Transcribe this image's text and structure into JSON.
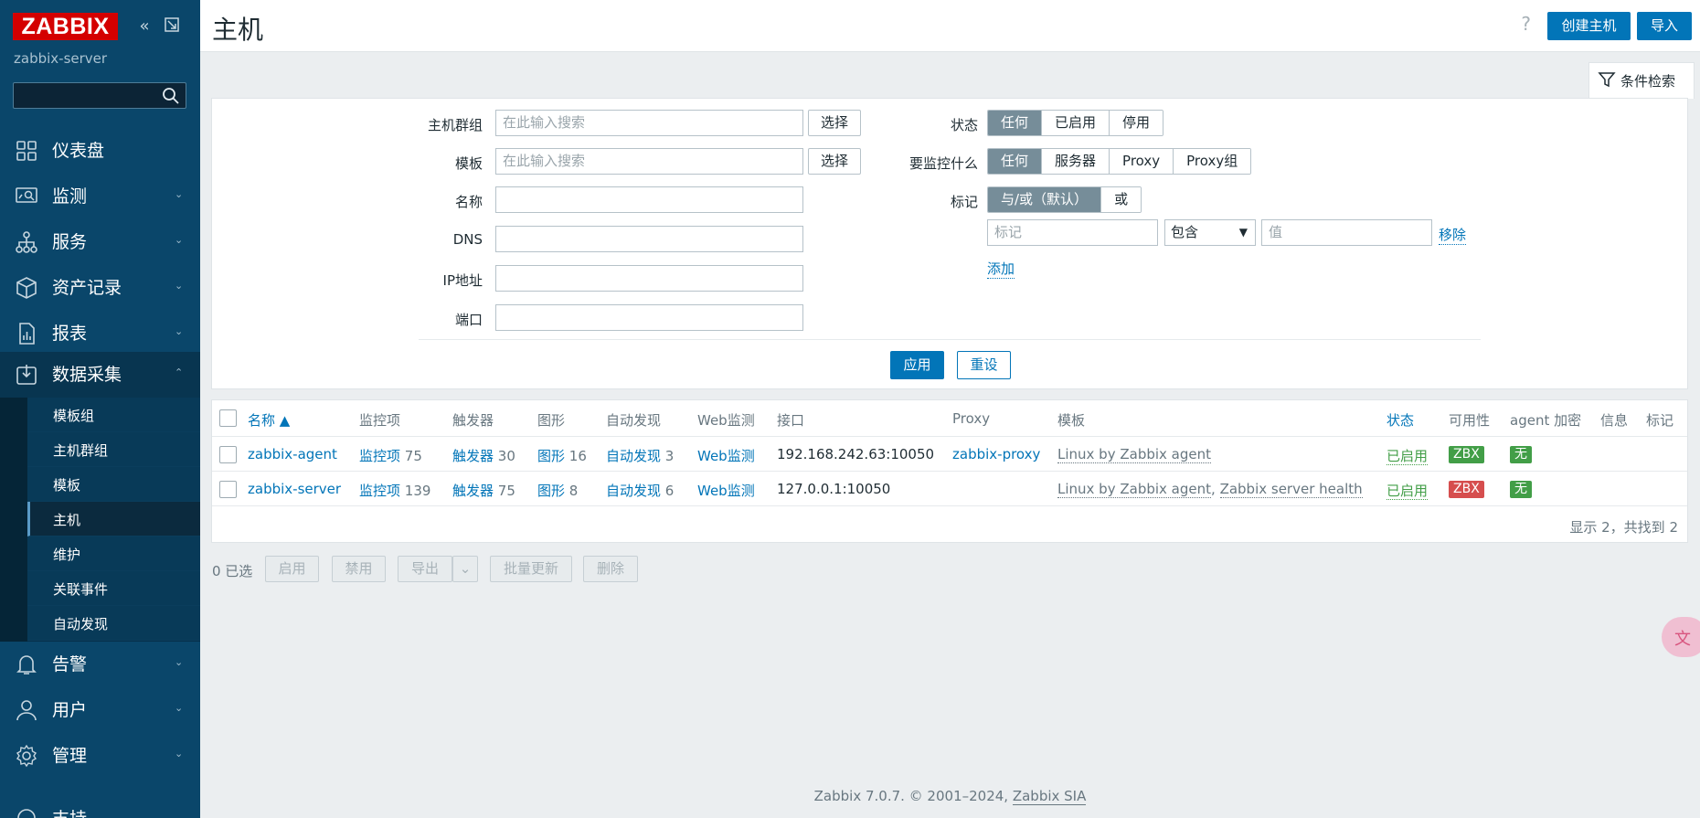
{
  "sidebar": {
    "logo": "ZABBIX",
    "server_name": "zabbix-server",
    "search_value": "",
    "menu": [
      {
        "label": "仪表盘"
      },
      {
        "label": "监测"
      },
      {
        "label": "服务"
      },
      {
        "label": "资产记录"
      },
      {
        "label": "报表"
      },
      {
        "label": "数据采集"
      },
      {
        "label": "告警"
      },
      {
        "label": "用户"
      },
      {
        "label": "管理"
      },
      {
        "label": "支持"
      }
    ],
    "submenu": [
      {
        "label": "模板组"
      },
      {
        "label": "主机群组"
      },
      {
        "label": "模板"
      },
      {
        "label": "主机"
      },
      {
        "label": "维护"
      },
      {
        "label": "关联事件"
      },
      {
        "label": "自动发现"
      }
    ]
  },
  "header": {
    "title": "主机",
    "help": "?",
    "create_button": "创建主机",
    "import_button": "导入"
  },
  "filter": {
    "tab_label": "条件检索",
    "host_groups_label": "主机群组",
    "host_groups_placeholder": "在此输入搜索",
    "templates_label": "模板",
    "templates_placeholder": "在此输入搜索",
    "select_button": "选择",
    "name_label": "名称",
    "dns_label": "DNS",
    "ip_label": "IP地址",
    "port_label": "端口",
    "status_label": "状态",
    "status_options": [
      "任何",
      "已启用",
      "停用"
    ],
    "monitored_by_label": "要监控什么",
    "monitored_by_options": [
      "任何",
      "服务器",
      "Proxy",
      "Proxy组"
    ],
    "tags_label": "标记",
    "tags_options": [
      "与/或（默认）",
      "或"
    ],
    "tag_placeholder": "标记",
    "tag_operator": "包含",
    "value_placeholder": "值",
    "remove_link": "移除",
    "add_link": "添加",
    "apply_button": "应用",
    "reset_button": "重设"
  },
  "table": {
    "columns": [
      "名称 ▲",
      "监控项",
      "触发器",
      "图形",
      "自动发现",
      "Web监测",
      "接口",
      "Proxy",
      "模板",
      "状态",
      "可用性",
      "agent 加密",
      "信息",
      "标记"
    ],
    "rows": [
      {
        "name": "zabbix-agent",
        "items_label": "监控项",
        "items_count": "75",
        "triggers_label": "触发器",
        "triggers_count": "30",
        "graphs_label": "图形",
        "graphs_count": "16",
        "discovery_label": "自动发现",
        "discovery_count": "3",
        "web": "Web监测",
        "interface": "192.168.242.63:10050",
        "proxy": "zabbix-proxy",
        "templates": [
          "Linux by Zabbix agent"
        ],
        "status": "已启用",
        "availability": "ZBX",
        "availability_color": "#429e47",
        "encryption": "无"
      },
      {
        "name": "zabbix-server",
        "items_label": "监控项",
        "items_count": "139",
        "triggers_label": "触发器",
        "triggers_count": "75",
        "graphs_label": "图形",
        "graphs_count": "8",
        "discovery_label": "自动发现",
        "discovery_count": "6",
        "web": "Web监测",
        "interface": "127.0.0.1:10050",
        "proxy": "",
        "templates": [
          "Linux by Zabbix agent",
          "Zabbix server health"
        ],
        "template_sep": ", ",
        "status": "已启用",
        "availability": "ZBX",
        "availability_color": "#d64e4e",
        "encryption": "无"
      }
    ],
    "footer": "显示 2，共找到 2"
  },
  "bulk": {
    "selected": "0 已选",
    "enable": "启用",
    "disable": "禁用",
    "export": "导出",
    "mass_update": "批量更新",
    "delete": "删除"
  },
  "footer": {
    "text": "Zabbix 7.0.7. © 2001–2024, ",
    "link": "Zabbix SIA"
  },
  "colors": {
    "sidebar": "#0a466a",
    "primary": "#0275b8",
    "logo": "#d40000",
    "enabled": "#429e47",
    "unavailable": "#d64e4e"
  }
}
